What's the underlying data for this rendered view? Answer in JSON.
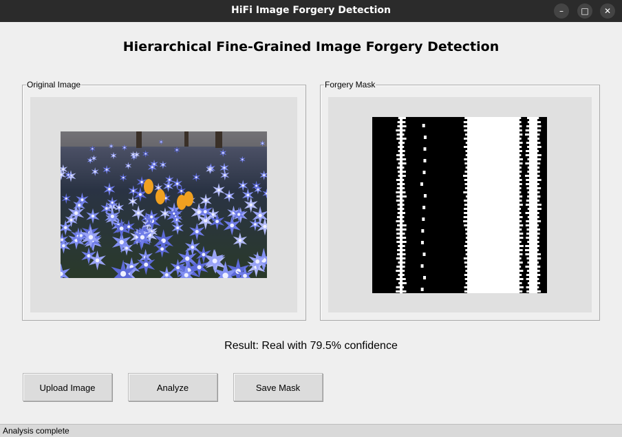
{
  "window": {
    "title": "HiFi Image Forgery Detection",
    "minimize_glyph": "–",
    "maximize_glyph": "□",
    "close_glyph": "✕"
  },
  "heading": "Hierarchical Fine-Grained Image Forgery Detection",
  "panels": {
    "original_label": "Original Image",
    "mask_label": "Forgery Mask"
  },
  "result": "Result: Real with 79.5% confidence",
  "buttons": {
    "upload": "Upload Image",
    "analyze": "Analyze",
    "save": "Save Mask"
  },
  "status": "Analysis complete",
  "colors": {
    "titlebar": "#2b2b2b",
    "window_bg": "#efefef",
    "canvas_bg": "#e0e0e0",
    "flower_blue": "#7f8ef0",
    "flower_orange": "#f0a020",
    "mask_black": "#000000",
    "mask_white": "#ffffff"
  }
}
